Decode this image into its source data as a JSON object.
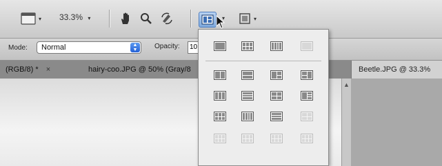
{
  "toolbar": {
    "zoom_value": "33.3%",
    "zoom_arrow": "▾",
    "screen_arrow": "▾",
    "layout_arrow": "▾",
    "extras_arrow": "▾"
  },
  "options": {
    "mode_label": "Mode:",
    "mode_value": "Normal",
    "opacity_label": "Opacity:",
    "opacity_value": "10"
  },
  "tabs": {
    "tab1_label": "(RGB/8) *",
    "tab1_close": "×",
    "tab2_label": "hairy-coo.JPG @ 50% (Gray/8",
    "tab3_label": "Beetle.JPG @ 33.3%"
  },
  "icons": {
    "screen_mode": "screen-mode-icon",
    "hand": "hand-tool-icon",
    "zoom": "zoom-tool-icon",
    "rotate": "rotate-view-icon",
    "arrange": "arrange-documents-icon",
    "extras": "screen-extras-icon",
    "cursor": "mouse-pointer-icon"
  },
  "colors": {
    "highlight": "#7fa9dd",
    "select_button": "#2561d6"
  }
}
